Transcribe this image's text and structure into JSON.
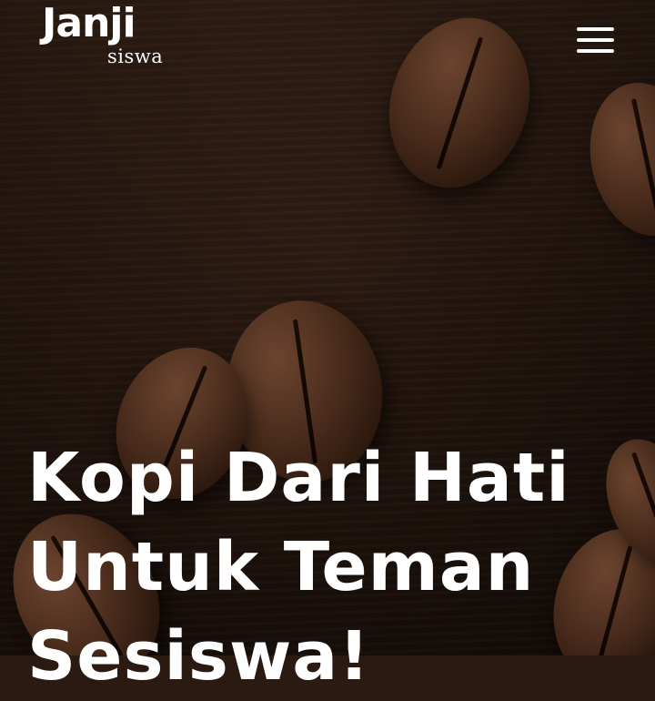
{
  "header": {
    "logo": {
      "main": "Janji",
      "sub": "siswa"
    },
    "menu_icon": "hamburger-menu-icon"
  },
  "hero": {
    "title_lines": [
      "Kopi Dari Hati",
      "Untuk Teman",
      "Sesiswa!"
    ],
    "text_color": "#ffffff"
  }
}
